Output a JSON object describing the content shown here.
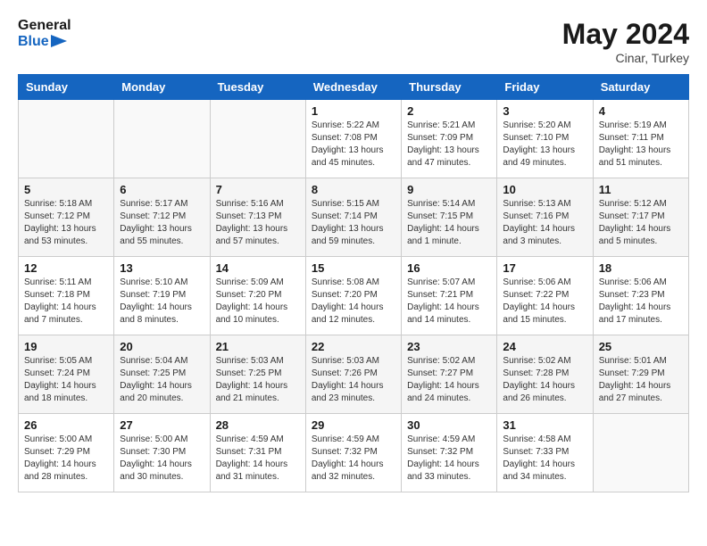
{
  "header": {
    "logo_general": "General",
    "logo_blue": "Blue",
    "month": "May 2024",
    "location": "Cinar, Turkey"
  },
  "weekdays": [
    "Sunday",
    "Monday",
    "Tuesday",
    "Wednesday",
    "Thursday",
    "Friday",
    "Saturday"
  ],
  "weeks": [
    [
      {
        "day": "",
        "info": ""
      },
      {
        "day": "",
        "info": ""
      },
      {
        "day": "",
        "info": ""
      },
      {
        "day": "1",
        "info": "Sunrise: 5:22 AM\nSunset: 7:08 PM\nDaylight: 13 hours\nand 45 minutes."
      },
      {
        "day": "2",
        "info": "Sunrise: 5:21 AM\nSunset: 7:09 PM\nDaylight: 13 hours\nand 47 minutes."
      },
      {
        "day": "3",
        "info": "Sunrise: 5:20 AM\nSunset: 7:10 PM\nDaylight: 13 hours\nand 49 minutes."
      },
      {
        "day": "4",
        "info": "Sunrise: 5:19 AM\nSunset: 7:11 PM\nDaylight: 13 hours\nand 51 minutes."
      }
    ],
    [
      {
        "day": "5",
        "info": "Sunrise: 5:18 AM\nSunset: 7:12 PM\nDaylight: 13 hours\nand 53 minutes."
      },
      {
        "day": "6",
        "info": "Sunrise: 5:17 AM\nSunset: 7:12 PM\nDaylight: 13 hours\nand 55 minutes."
      },
      {
        "day": "7",
        "info": "Sunrise: 5:16 AM\nSunset: 7:13 PM\nDaylight: 13 hours\nand 57 minutes."
      },
      {
        "day": "8",
        "info": "Sunrise: 5:15 AM\nSunset: 7:14 PM\nDaylight: 13 hours\nand 59 minutes."
      },
      {
        "day": "9",
        "info": "Sunrise: 5:14 AM\nSunset: 7:15 PM\nDaylight: 14 hours\nand 1 minute."
      },
      {
        "day": "10",
        "info": "Sunrise: 5:13 AM\nSunset: 7:16 PM\nDaylight: 14 hours\nand 3 minutes."
      },
      {
        "day": "11",
        "info": "Sunrise: 5:12 AM\nSunset: 7:17 PM\nDaylight: 14 hours\nand 5 minutes."
      }
    ],
    [
      {
        "day": "12",
        "info": "Sunrise: 5:11 AM\nSunset: 7:18 PM\nDaylight: 14 hours\nand 7 minutes."
      },
      {
        "day": "13",
        "info": "Sunrise: 5:10 AM\nSunset: 7:19 PM\nDaylight: 14 hours\nand 8 minutes."
      },
      {
        "day": "14",
        "info": "Sunrise: 5:09 AM\nSunset: 7:20 PM\nDaylight: 14 hours\nand 10 minutes."
      },
      {
        "day": "15",
        "info": "Sunrise: 5:08 AM\nSunset: 7:20 PM\nDaylight: 14 hours\nand 12 minutes."
      },
      {
        "day": "16",
        "info": "Sunrise: 5:07 AM\nSunset: 7:21 PM\nDaylight: 14 hours\nand 14 minutes."
      },
      {
        "day": "17",
        "info": "Sunrise: 5:06 AM\nSunset: 7:22 PM\nDaylight: 14 hours\nand 15 minutes."
      },
      {
        "day": "18",
        "info": "Sunrise: 5:06 AM\nSunset: 7:23 PM\nDaylight: 14 hours\nand 17 minutes."
      }
    ],
    [
      {
        "day": "19",
        "info": "Sunrise: 5:05 AM\nSunset: 7:24 PM\nDaylight: 14 hours\nand 18 minutes."
      },
      {
        "day": "20",
        "info": "Sunrise: 5:04 AM\nSunset: 7:25 PM\nDaylight: 14 hours\nand 20 minutes."
      },
      {
        "day": "21",
        "info": "Sunrise: 5:03 AM\nSunset: 7:25 PM\nDaylight: 14 hours\nand 21 minutes."
      },
      {
        "day": "22",
        "info": "Sunrise: 5:03 AM\nSunset: 7:26 PM\nDaylight: 14 hours\nand 23 minutes."
      },
      {
        "day": "23",
        "info": "Sunrise: 5:02 AM\nSunset: 7:27 PM\nDaylight: 14 hours\nand 24 minutes."
      },
      {
        "day": "24",
        "info": "Sunrise: 5:02 AM\nSunset: 7:28 PM\nDaylight: 14 hours\nand 26 minutes."
      },
      {
        "day": "25",
        "info": "Sunrise: 5:01 AM\nSunset: 7:29 PM\nDaylight: 14 hours\nand 27 minutes."
      }
    ],
    [
      {
        "day": "26",
        "info": "Sunrise: 5:00 AM\nSunset: 7:29 PM\nDaylight: 14 hours\nand 28 minutes."
      },
      {
        "day": "27",
        "info": "Sunrise: 5:00 AM\nSunset: 7:30 PM\nDaylight: 14 hours\nand 30 minutes."
      },
      {
        "day": "28",
        "info": "Sunrise: 4:59 AM\nSunset: 7:31 PM\nDaylight: 14 hours\nand 31 minutes."
      },
      {
        "day": "29",
        "info": "Sunrise: 4:59 AM\nSunset: 7:32 PM\nDaylight: 14 hours\nand 32 minutes."
      },
      {
        "day": "30",
        "info": "Sunrise: 4:59 AM\nSunset: 7:32 PM\nDaylight: 14 hours\nand 33 minutes."
      },
      {
        "day": "31",
        "info": "Sunrise: 4:58 AM\nSunset: 7:33 PM\nDaylight: 14 hours\nand 34 minutes."
      },
      {
        "day": "",
        "info": ""
      }
    ]
  ]
}
